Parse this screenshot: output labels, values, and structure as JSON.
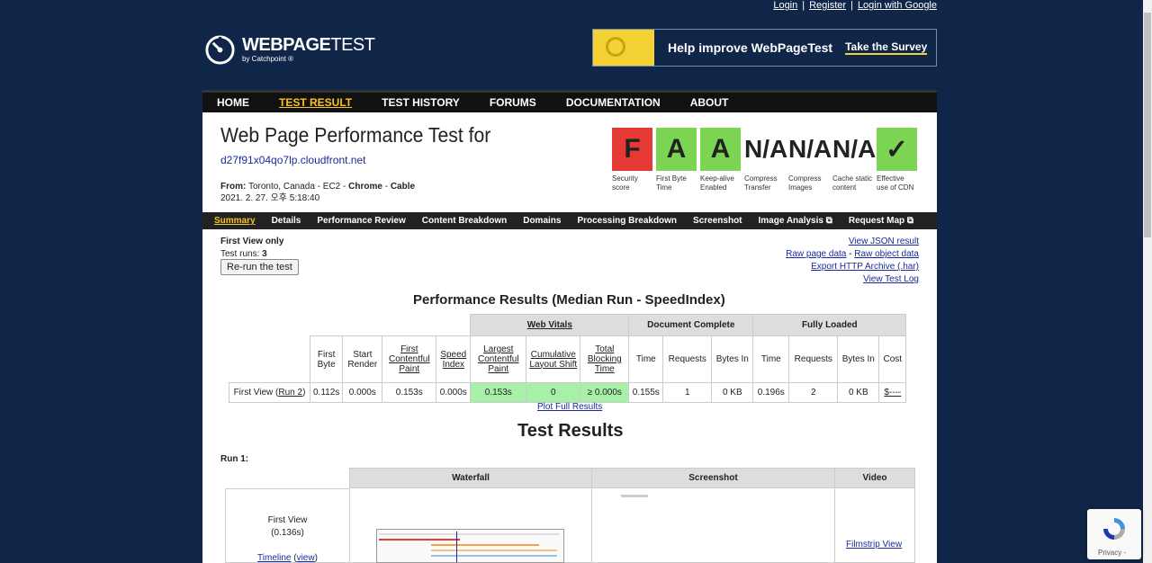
{
  "account": {
    "login": "Login",
    "register": "Register",
    "google": "Login with Google",
    "sep": "|"
  },
  "logo": {
    "name_bold": "WEBPAGE",
    "name_light": "TEST",
    "by": "by Catchpoint ®"
  },
  "banner": {
    "message": "Help improve WebPageTest",
    "cta": "Take the Survey"
  },
  "nav": {
    "items": [
      "HOME",
      "TEST RESULT",
      "TEST HISTORY",
      "FORUMS",
      "DOCUMENTATION",
      "ABOUT"
    ]
  },
  "header": {
    "title": "Web Page Performance Test for",
    "url": "d27f91x04qo7lp.cloudfront.net",
    "from_label": "From:",
    "from_value": "Toronto, Canada - EC2 -",
    "browser": "Chrome",
    "dash": "-",
    "connection": "Cable",
    "datetime": "2021. 2. 27. 오후 5:18:40"
  },
  "grades": [
    {
      "grade": "F",
      "label": "Security score",
      "color": "#e53935"
    },
    {
      "grade": "A",
      "label": "First Byte Time",
      "color": "#7cd552"
    },
    {
      "grade": "A",
      "label": "Keep-alive Enabled",
      "color": "#7cd552"
    },
    {
      "grade": "N/A",
      "label": "Compress Transfer"
    },
    {
      "grade": "N/A",
      "label": "Compress Images"
    },
    {
      "grade": "N/A",
      "label": "Cache static content"
    },
    {
      "grade": "✓",
      "label": "Effective use of CDN",
      "color": "#7cd552"
    }
  ],
  "subnav": {
    "items": [
      "Summary",
      "Details",
      "Performance Review",
      "Content Breakdown",
      "Domains",
      "Processing Breakdown",
      "Screenshot",
      "Image Analysis ⧉",
      "Request Map ⧉"
    ]
  },
  "summary": {
    "first_view_only": "First View only",
    "test_runs_label": "Test runs:",
    "test_runs": "3",
    "rerun": "Re-run the test",
    "links": [
      "View JSON result",
      "Raw page data",
      "Raw object data",
      "Export HTTP Archive (.har)",
      "View Test Log"
    ],
    "raw_sep": "-"
  },
  "results": {
    "title": "Performance Results (Median Run - SpeedIndex)",
    "groups": {
      "web_vitals": "Web Vitals",
      "document_complete": "Document Complete",
      "fully_loaded": "Fully Loaded"
    },
    "columns": {
      "first_byte": "First Byte",
      "start_render": "Start Render",
      "fcp": "First Contentful Paint",
      "speed_index": "Speed Index",
      "lcp": "Largest Contentful Paint",
      "cls": "Cumulative Layout Shift",
      "tbt": "Total Blocking Time",
      "dc_time": "Time",
      "dc_requests": "Requests",
      "dc_bytes": "Bytes In",
      "fl_time": "Time",
      "fl_requests": "Requests",
      "fl_bytes": "Bytes In",
      "cost": "Cost"
    },
    "row": {
      "label": "First View (",
      "run_link": "Run 2",
      "label_end": ")",
      "first_byte": "0.112s",
      "start_render": "0.000s",
      "fcp": "0.153s",
      "speed_index": "0.000s",
      "lcp": "0.153s",
      "cls": "0",
      "tbt": "≥ 0.000s",
      "dc_time": "0.155s",
      "dc_requests": "1",
      "dc_bytes": "0 KB",
      "fl_time": "0.196s",
      "fl_requests": "2",
      "fl_bytes": "0 KB",
      "cost": "$----"
    },
    "plot_link": "Plot Full Results"
  },
  "test_results": {
    "title": "Test Results",
    "run_label": "Run 1:",
    "headers": {
      "waterfall": "Waterfall",
      "screenshot": "Screenshot",
      "video": "Video"
    },
    "first_view": "First View",
    "fv_time": "(0.136s)",
    "timeline": "Timeline",
    "view": "view",
    "filmstrip": "Filmstrip View"
  },
  "recaptcha": {
    "privacy": "Privacy -"
  }
}
